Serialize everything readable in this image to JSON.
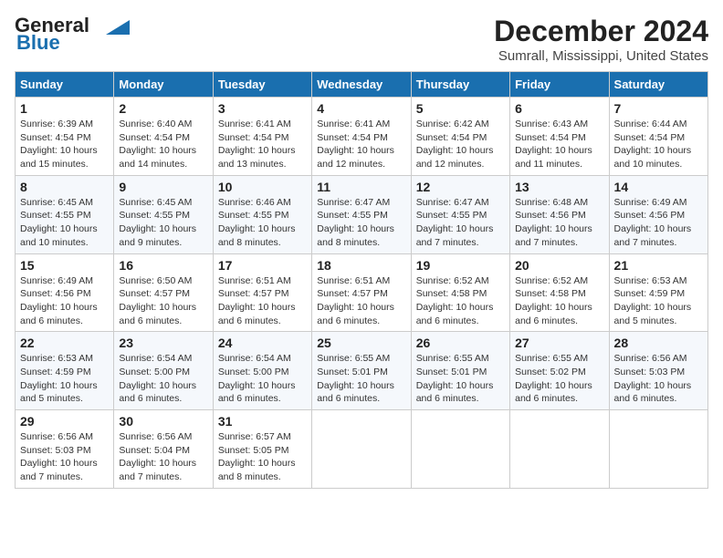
{
  "header": {
    "logo_line1": "General",
    "logo_line2": "Blue",
    "month": "December 2024",
    "location": "Sumrall, Mississippi, United States"
  },
  "weekdays": [
    "Sunday",
    "Monday",
    "Tuesday",
    "Wednesday",
    "Thursday",
    "Friday",
    "Saturday"
  ],
  "weeks": [
    [
      {
        "day": "1",
        "info": "Sunrise: 6:39 AM\nSunset: 4:54 PM\nDaylight: 10 hours\nand 15 minutes."
      },
      {
        "day": "2",
        "info": "Sunrise: 6:40 AM\nSunset: 4:54 PM\nDaylight: 10 hours\nand 14 minutes."
      },
      {
        "day": "3",
        "info": "Sunrise: 6:41 AM\nSunset: 4:54 PM\nDaylight: 10 hours\nand 13 minutes."
      },
      {
        "day": "4",
        "info": "Sunrise: 6:41 AM\nSunset: 4:54 PM\nDaylight: 10 hours\nand 12 minutes."
      },
      {
        "day": "5",
        "info": "Sunrise: 6:42 AM\nSunset: 4:54 PM\nDaylight: 10 hours\nand 12 minutes."
      },
      {
        "day": "6",
        "info": "Sunrise: 6:43 AM\nSunset: 4:54 PM\nDaylight: 10 hours\nand 11 minutes."
      },
      {
        "day": "7",
        "info": "Sunrise: 6:44 AM\nSunset: 4:54 PM\nDaylight: 10 hours\nand 10 minutes."
      }
    ],
    [
      {
        "day": "8",
        "info": "Sunrise: 6:45 AM\nSunset: 4:55 PM\nDaylight: 10 hours\nand 10 minutes."
      },
      {
        "day": "9",
        "info": "Sunrise: 6:45 AM\nSunset: 4:55 PM\nDaylight: 10 hours\nand 9 minutes."
      },
      {
        "day": "10",
        "info": "Sunrise: 6:46 AM\nSunset: 4:55 PM\nDaylight: 10 hours\nand 8 minutes."
      },
      {
        "day": "11",
        "info": "Sunrise: 6:47 AM\nSunset: 4:55 PM\nDaylight: 10 hours\nand 8 minutes."
      },
      {
        "day": "12",
        "info": "Sunrise: 6:47 AM\nSunset: 4:55 PM\nDaylight: 10 hours\nand 7 minutes."
      },
      {
        "day": "13",
        "info": "Sunrise: 6:48 AM\nSunset: 4:56 PM\nDaylight: 10 hours\nand 7 minutes."
      },
      {
        "day": "14",
        "info": "Sunrise: 6:49 AM\nSunset: 4:56 PM\nDaylight: 10 hours\nand 7 minutes."
      }
    ],
    [
      {
        "day": "15",
        "info": "Sunrise: 6:49 AM\nSunset: 4:56 PM\nDaylight: 10 hours\nand 6 minutes."
      },
      {
        "day": "16",
        "info": "Sunrise: 6:50 AM\nSunset: 4:57 PM\nDaylight: 10 hours\nand 6 minutes."
      },
      {
        "day": "17",
        "info": "Sunrise: 6:51 AM\nSunset: 4:57 PM\nDaylight: 10 hours\nand 6 minutes."
      },
      {
        "day": "18",
        "info": "Sunrise: 6:51 AM\nSunset: 4:57 PM\nDaylight: 10 hours\nand 6 minutes."
      },
      {
        "day": "19",
        "info": "Sunrise: 6:52 AM\nSunset: 4:58 PM\nDaylight: 10 hours\nand 6 minutes."
      },
      {
        "day": "20",
        "info": "Sunrise: 6:52 AM\nSunset: 4:58 PM\nDaylight: 10 hours\nand 6 minutes."
      },
      {
        "day": "21",
        "info": "Sunrise: 6:53 AM\nSunset: 4:59 PM\nDaylight: 10 hours\nand 5 minutes."
      }
    ],
    [
      {
        "day": "22",
        "info": "Sunrise: 6:53 AM\nSunset: 4:59 PM\nDaylight: 10 hours\nand 5 minutes."
      },
      {
        "day": "23",
        "info": "Sunrise: 6:54 AM\nSunset: 5:00 PM\nDaylight: 10 hours\nand 6 minutes."
      },
      {
        "day": "24",
        "info": "Sunrise: 6:54 AM\nSunset: 5:00 PM\nDaylight: 10 hours\nand 6 minutes."
      },
      {
        "day": "25",
        "info": "Sunrise: 6:55 AM\nSunset: 5:01 PM\nDaylight: 10 hours\nand 6 minutes."
      },
      {
        "day": "26",
        "info": "Sunrise: 6:55 AM\nSunset: 5:01 PM\nDaylight: 10 hours\nand 6 minutes."
      },
      {
        "day": "27",
        "info": "Sunrise: 6:55 AM\nSunset: 5:02 PM\nDaylight: 10 hours\nand 6 minutes."
      },
      {
        "day": "28",
        "info": "Sunrise: 6:56 AM\nSunset: 5:03 PM\nDaylight: 10 hours\nand 6 minutes."
      }
    ],
    [
      {
        "day": "29",
        "info": "Sunrise: 6:56 AM\nSunset: 5:03 PM\nDaylight: 10 hours\nand 7 minutes."
      },
      {
        "day": "30",
        "info": "Sunrise: 6:56 AM\nSunset: 5:04 PM\nDaylight: 10 hours\nand 7 minutes."
      },
      {
        "day": "31",
        "info": "Sunrise: 6:57 AM\nSunset: 5:05 PM\nDaylight: 10 hours\nand 8 minutes."
      },
      {
        "day": "",
        "info": ""
      },
      {
        "day": "",
        "info": ""
      },
      {
        "day": "",
        "info": ""
      },
      {
        "day": "",
        "info": ""
      }
    ]
  ]
}
